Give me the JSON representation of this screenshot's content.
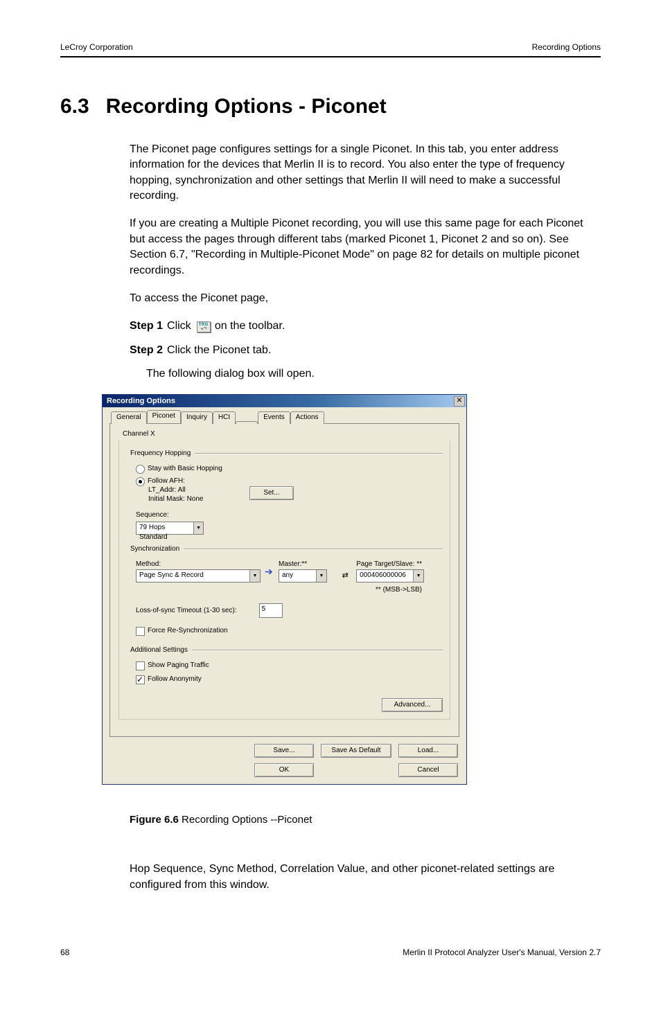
{
  "header": {
    "left": "LeCroy Corporation",
    "right": "Recording Options"
  },
  "section": {
    "number": "6.3",
    "title": "Recording Options - Piconet"
  },
  "para1": "The Piconet page configures settings for a single Piconet. In this tab, you enter address information for the devices that Merlin II is to record. You also enter the type of frequency hopping, synchronization and other settings that Merlin II will need to make a successful recording.",
  "para2": "If you are creating a Multiple Piconet recording, you will use this same page for each Piconet but access the pages through different tabs (marked Piconet 1, Piconet 2 and so on). See Section 6.7, \"Recording in Multiple-Piconet Mode\" on page 82 for details on multiple piconet recordings.",
  "steps": {
    "lead": "To access the Piconet page,",
    "s1_label": "Step 1",
    "s1_text": "Click",
    "s1_after": "on the toolbar.",
    "s2_label": "Step 2",
    "s2_text": "Click the Piconet tab.",
    "dialog_intro": "The following dialog box will open."
  },
  "dlg": {
    "title": "Recording Options",
    "tabs": [
      "General",
      "Piconet",
      "Inquiry",
      "HCI",
      "",
      "Events",
      "Actions"
    ],
    "channel": "Channel X",
    "fs_freq": "Frequency Hopping",
    "radio_basic": "Stay with Basic Hopping",
    "radio_afh": "Follow AFH:",
    "afh_line1": "LT_Addr: All",
    "afh_line2": "Initial Mask: None",
    "btn_set": "Set...",
    "seq_label": "Sequence:",
    "seq_val": "79 Hops Standard",
    "fs_sync": "Synchronization",
    "method_label": "Method:",
    "method_val": "Page Sync & Record",
    "master_label": "Master:**",
    "master_val": "any",
    "slave_label": "Page Target/Slave: **",
    "slave_val": "000406000006",
    "msb_note": "** (MSB->LSB)",
    "los_label": "Loss-of-sync Timeout (1-30 sec):",
    "los_val": "5",
    "force_resync": "Force Re-Synchronization",
    "fs_add": "Additional Settings",
    "show_paging": "Show Paging Traffic",
    "follow_anon": "Follow Anonymity",
    "btn_adv": "Advanced...",
    "btn_save": "Save...",
    "btn_savedef": "Save As Default",
    "btn_load": "Load...",
    "btn_ok": "OK",
    "btn_cancel": "Cancel"
  },
  "caption": {
    "bold": "Figure 6.6",
    "text": "  Recording Options --Piconet"
  },
  "para3": "Hop Sequence, Sync Method, Correlation Value, and other piconet-related settings are configured from this window.",
  "footer": {
    "left": "68",
    "right": "Merlin II Protocol Analyzer User's Manual, Version 2.7"
  }
}
